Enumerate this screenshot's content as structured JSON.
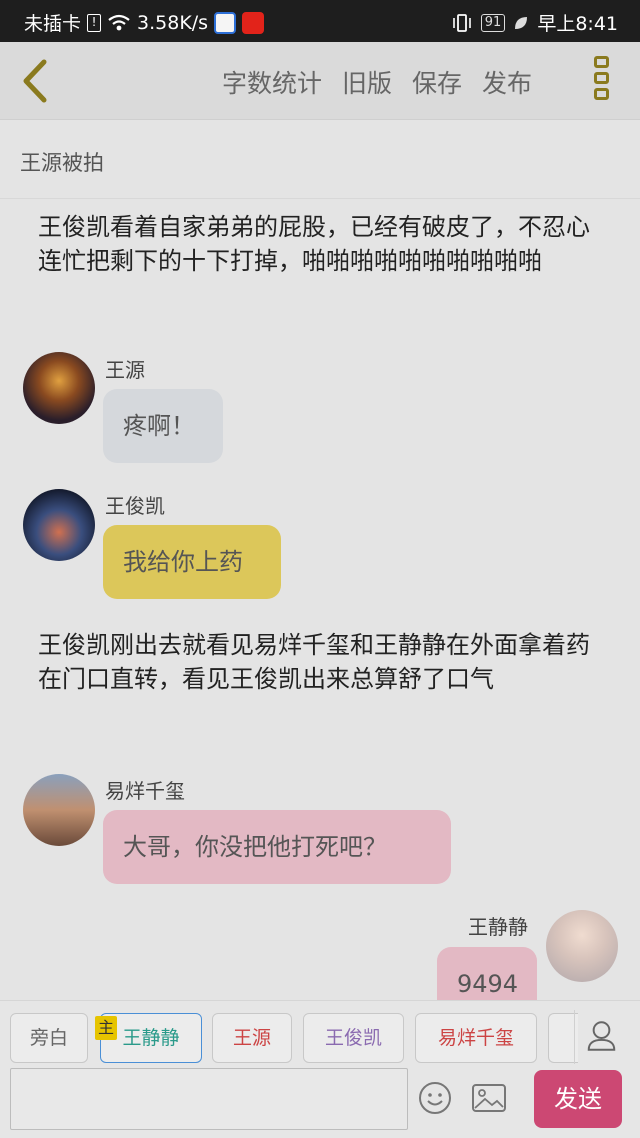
{
  "status_bar": {
    "carrier": "未插卡",
    "speed": "3.58K/s",
    "battery": "91",
    "time": "早上8:41"
  },
  "toolbar": {
    "word_count": "字数统计",
    "old_version": "旧版",
    "save": "保存",
    "publish": "发布"
  },
  "chapter_title": "王源被拍",
  "content": {
    "narration1": "王俊凯看着自家弟弟的屁股，已经有破皮了，不忍心连忙把剩下的十下打掉，啪啪啪啪啪啪啪啪啪啪",
    "msg1": {
      "name": "王源",
      "text": "疼啊！"
    },
    "msg2": {
      "name": "王俊凯",
      "text": "我给你上药"
    },
    "narration2": "王俊凯刚出去就看见易烊千玺和王静静在外面拿着药在门口直转，看见王俊凯出来总算舒了口气",
    "msg3": {
      "name": "易烊千玺",
      "text": "大哥，你没把他打死吧？"
    },
    "msg4": {
      "name": "王静静",
      "text": "9494"
    }
  },
  "roles": {
    "narrator": "旁白",
    "main_badge": "主",
    "r1": "王静静",
    "r2": "王源",
    "r3": "王俊凯",
    "r4": "易烊千玺"
  },
  "input": {
    "send": "发送",
    "placeholder": ""
  },
  "colors": {
    "accent": "#cc4873",
    "gold": "#8a7a1e",
    "bubble_grey": "#d5d8dc",
    "bubble_yellow": "#dcc75a",
    "bubble_pink": "#e3b9c4"
  }
}
